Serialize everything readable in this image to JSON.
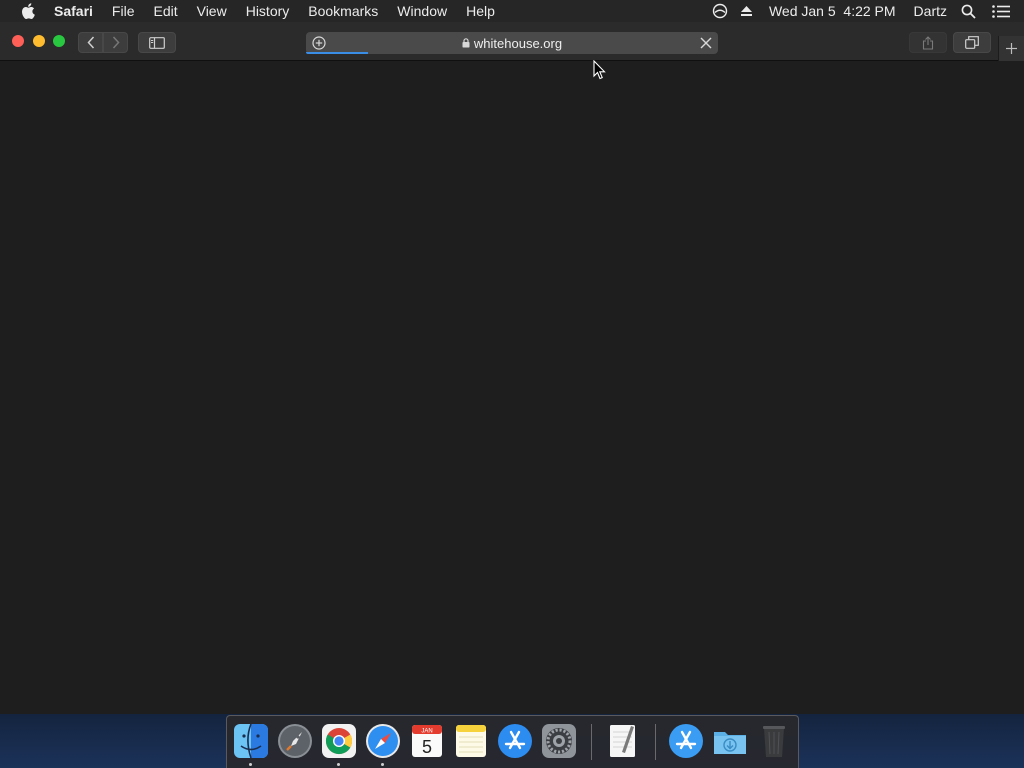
{
  "menubar": {
    "apple_icon": "apple-icon",
    "app_name": "Safari",
    "items": [
      "File",
      "Edit",
      "View",
      "History",
      "Bookmarks",
      "Window",
      "Help"
    ],
    "status_icons": [
      "sync-icon",
      "eject-icon"
    ],
    "clock": "Wed Jan 5  4:22 PM",
    "user": "Dartz",
    "right_icons": [
      "spotlight-search-icon",
      "notification-center-icon"
    ]
  },
  "toolbar": {
    "window_controls": [
      "close",
      "minimize",
      "zoom"
    ],
    "address_bar": {
      "url": "whitehouse.org",
      "secure": true,
      "loading_progress": 0.15
    }
  },
  "dock": {
    "apps": [
      {
        "name": "Finder",
        "icon": "finder-icon",
        "running": true
      },
      {
        "name": "Launchpad",
        "icon": "launchpad-icon",
        "running": false
      },
      {
        "name": "Google Chrome",
        "icon": "chrome-icon",
        "running": true
      },
      {
        "name": "Safari",
        "icon": "safari-icon",
        "running": true
      },
      {
        "name": "Calendar",
        "icon": "calendar-icon",
        "running": false,
        "month": "JAN",
        "day": "5"
      },
      {
        "name": "Notes",
        "icon": "notes-icon",
        "running": false
      },
      {
        "name": "App Store",
        "icon": "app-store-icon",
        "running": false
      },
      {
        "name": "System Preferences",
        "icon": "system-preferences-icon",
        "running": false
      },
      {
        "name": "TextEdit",
        "icon": "textedit-icon",
        "running": false
      },
      {
        "name": "Applications",
        "icon": "applications-folder-icon",
        "running": false
      },
      {
        "name": "Downloads",
        "icon": "downloads-folder-icon",
        "running": false
      },
      {
        "name": "Trash",
        "icon": "trash-icon",
        "running": false
      }
    ]
  }
}
